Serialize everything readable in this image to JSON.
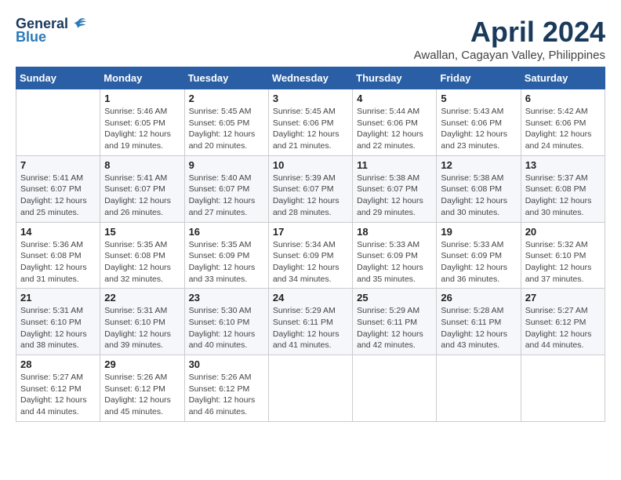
{
  "header": {
    "logo_general": "General",
    "logo_blue": "Blue",
    "month_year": "April 2024",
    "location": "Awallan, Cagayan Valley, Philippines"
  },
  "weekdays": [
    "Sunday",
    "Monday",
    "Tuesday",
    "Wednesday",
    "Thursday",
    "Friday",
    "Saturday"
  ],
  "weeks": [
    [
      {
        "day": "",
        "info": ""
      },
      {
        "day": "1",
        "info": "Sunrise: 5:46 AM\nSunset: 6:05 PM\nDaylight: 12 hours\nand 19 minutes."
      },
      {
        "day": "2",
        "info": "Sunrise: 5:45 AM\nSunset: 6:05 PM\nDaylight: 12 hours\nand 20 minutes."
      },
      {
        "day": "3",
        "info": "Sunrise: 5:45 AM\nSunset: 6:06 PM\nDaylight: 12 hours\nand 21 minutes."
      },
      {
        "day": "4",
        "info": "Sunrise: 5:44 AM\nSunset: 6:06 PM\nDaylight: 12 hours\nand 22 minutes."
      },
      {
        "day": "5",
        "info": "Sunrise: 5:43 AM\nSunset: 6:06 PM\nDaylight: 12 hours\nand 23 minutes."
      },
      {
        "day": "6",
        "info": "Sunrise: 5:42 AM\nSunset: 6:06 PM\nDaylight: 12 hours\nand 24 minutes."
      }
    ],
    [
      {
        "day": "7",
        "info": "Sunrise: 5:41 AM\nSunset: 6:07 PM\nDaylight: 12 hours\nand 25 minutes."
      },
      {
        "day": "8",
        "info": "Sunrise: 5:41 AM\nSunset: 6:07 PM\nDaylight: 12 hours\nand 26 minutes."
      },
      {
        "day": "9",
        "info": "Sunrise: 5:40 AM\nSunset: 6:07 PM\nDaylight: 12 hours\nand 27 minutes."
      },
      {
        "day": "10",
        "info": "Sunrise: 5:39 AM\nSunset: 6:07 PM\nDaylight: 12 hours\nand 28 minutes."
      },
      {
        "day": "11",
        "info": "Sunrise: 5:38 AM\nSunset: 6:07 PM\nDaylight: 12 hours\nand 29 minutes."
      },
      {
        "day": "12",
        "info": "Sunrise: 5:38 AM\nSunset: 6:08 PM\nDaylight: 12 hours\nand 30 minutes."
      },
      {
        "day": "13",
        "info": "Sunrise: 5:37 AM\nSunset: 6:08 PM\nDaylight: 12 hours\nand 30 minutes."
      }
    ],
    [
      {
        "day": "14",
        "info": "Sunrise: 5:36 AM\nSunset: 6:08 PM\nDaylight: 12 hours\nand 31 minutes."
      },
      {
        "day": "15",
        "info": "Sunrise: 5:35 AM\nSunset: 6:08 PM\nDaylight: 12 hours\nand 32 minutes."
      },
      {
        "day": "16",
        "info": "Sunrise: 5:35 AM\nSunset: 6:09 PM\nDaylight: 12 hours\nand 33 minutes."
      },
      {
        "day": "17",
        "info": "Sunrise: 5:34 AM\nSunset: 6:09 PM\nDaylight: 12 hours\nand 34 minutes."
      },
      {
        "day": "18",
        "info": "Sunrise: 5:33 AM\nSunset: 6:09 PM\nDaylight: 12 hours\nand 35 minutes."
      },
      {
        "day": "19",
        "info": "Sunrise: 5:33 AM\nSunset: 6:09 PM\nDaylight: 12 hours\nand 36 minutes."
      },
      {
        "day": "20",
        "info": "Sunrise: 5:32 AM\nSunset: 6:10 PM\nDaylight: 12 hours\nand 37 minutes."
      }
    ],
    [
      {
        "day": "21",
        "info": "Sunrise: 5:31 AM\nSunset: 6:10 PM\nDaylight: 12 hours\nand 38 minutes."
      },
      {
        "day": "22",
        "info": "Sunrise: 5:31 AM\nSunset: 6:10 PM\nDaylight: 12 hours\nand 39 minutes."
      },
      {
        "day": "23",
        "info": "Sunrise: 5:30 AM\nSunset: 6:10 PM\nDaylight: 12 hours\nand 40 minutes."
      },
      {
        "day": "24",
        "info": "Sunrise: 5:29 AM\nSunset: 6:11 PM\nDaylight: 12 hours\nand 41 minutes."
      },
      {
        "day": "25",
        "info": "Sunrise: 5:29 AM\nSunset: 6:11 PM\nDaylight: 12 hours\nand 42 minutes."
      },
      {
        "day": "26",
        "info": "Sunrise: 5:28 AM\nSunset: 6:11 PM\nDaylight: 12 hours\nand 43 minutes."
      },
      {
        "day": "27",
        "info": "Sunrise: 5:27 AM\nSunset: 6:12 PM\nDaylight: 12 hours\nand 44 minutes."
      }
    ],
    [
      {
        "day": "28",
        "info": "Sunrise: 5:27 AM\nSunset: 6:12 PM\nDaylight: 12 hours\nand 44 minutes."
      },
      {
        "day": "29",
        "info": "Sunrise: 5:26 AM\nSunset: 6:12 PM\nDaylight: 12 hours\nand 45 minutes."
      },
      {
        "day": "30",
        "info": "Sunrise: 5:26 AM\nSunset: 6:12 PM\nDaylight: 12 hours\nand 46 minutes."
      },
      {
        "day": "",
        "info": ""
      },
      {
        "day": "",
        "info": ""
      },
      {
        "day": "",
        "info": ""
      },
      {
        "day": "",
        "info": ""
      }
    ]
  ]
}
